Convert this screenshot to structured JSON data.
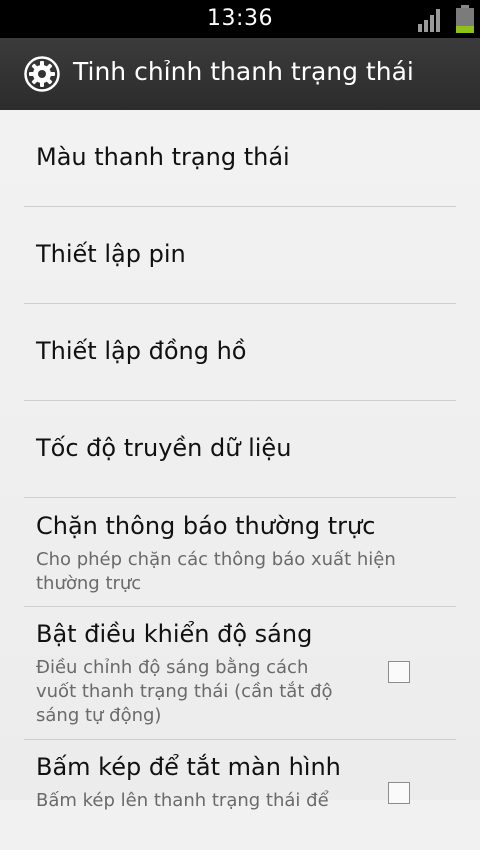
{
  "status_bar": {
    "time": "13:36",
    "signal_icon": "signal-bars-icon",
    "battery_icon": "battery-icon",
    "battery_level": 0.3,
    "battery_color": "#8ec21b"
  },
  "action_bar": {
    "icon": "gear-icon",
    "title": "Tinh chỉnh thanh trạng thái"
  },
  "items": [
    {
      "label": "Màu thanh trạng thái"
    },
    {
      "label": "Thiết lập pin"
    },
    {
      "label": "Thiết lập đồng hồ"
    },
    {
      "label": "Tốc độ truyền dữ liệu"
    },
    {
      "label": "Chặn thông báo thường trực",
      "summary": "Cho phép chặn các thông báo xuất hiện thường trực"
    },
    {
      "label": "Bật điều khiển độ sáng",
      "summary": "Điều chỉnh độ sáng bằng cách vuốt thanh trạng thái (cần tắt độ sáng tự động)",
      "checked": false
    },
    {
      "label": "Bấm kép để tắt màn hình",
      "summary": "Bấm kép lên thanh trạng thái để",
      "checked": false
    }
  ]
}
